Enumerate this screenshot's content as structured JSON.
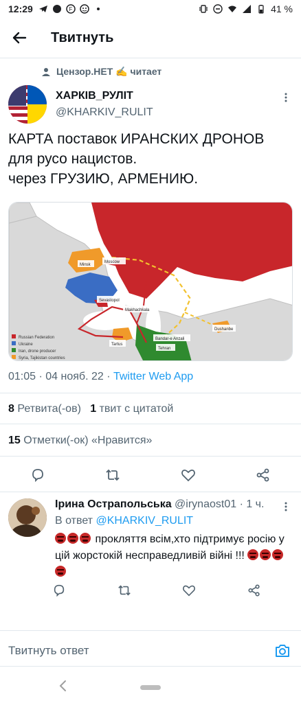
{
  "status_bar": {
    "time": "12:29",
    "battery": "41 %",
    "icons_left": [
      "telegram-icon",
      "dot-icon",
      "f-badge-icon",
      "emoji-icon",
      "small-dot-icon"
    ],
    "icons_right": [
      "vibrate-icon",
      "dnd-icon",
      "wifi-icon",
      "signal-icon",
      "battery-icon"
    ]
  },
  "app_bar": {
    "title": "Твитнуть"
  },
  "tweet": {
    "social_context": "Цензор.НЕТ ✍️ читает",
    "author_name": "ХАРКІВ_РУЛІТ",
    "author_handle": "@KHARKIV_RULIT",
    "text": "КАРТА поставок ИРАНСКИХ ДРОНОВ для русо нацистов.\nчерез ГРУЗИЮ, АРМЕНИЮ.",
    "meta_time": "01:05 · 04 нояб. 22 · ",
    "meta_source": "Twitter Web App",
    "retweets_count": "8",
    "retweets_label": "Ретвита(-ов)",
    "quotes_count": "1",
    "quotes_label": "твит с цитатой",
    "likes_count": "15",
    "likes_label": "Отметки(-ок) «Нравится»"
  },
  "map": {
    "labels": {
      "moscow": "Moscow",
      "minsk": "Minsk",
      "sevastopol": "Sevastopol",
      "makhachkala": "Makhachkala",
      "bandar": "Bandar-e Anzali",
      "tehran": "Tehran",
      "tartus": "Tartus",
      "dushanbe": "Dushanbe"
    },
    "legend": [
      {
        "label": "Russian Federation",
        "color": "#c8262b"
      },
      {
        "label": "Ukraine",
        "color": "#3a6dc4"
      },
      {
        "label": "Iran, drone producer",
        "color": "#2f8a2f"
      },
      {
        "label": "Syria, Tajikistan countries",
        "color": "#f09a2a"
      }
    ],
    "colors": {
      "russia": "#c8262b",
      "ukraine": "#3a6dc4",
      "iran": "#2f8a2f",
      "allies": "#f09a2a",
      "land": "#d9d9d9",
      "sea": "#ffffff",
      "route_red": "#c8262b",
      "route_yellow": "#f2c12e"
    }
  },
  "reply": {
    "name": "Ірина Острапольська",
    "handle": "@irynaost01",
    "time": "· 1 ч.",
    "reply_to_prefix": "В ответ ",
    "reply_to_handle": "@KHARKIV_RULIT",
    "text_part1": " прокляття всім,хто підтримує росію у цій жорстокій несправедливій війні !!!"
  },
  "compose": {
    "placeholder": "Твитнуть ответ"
  }
}
